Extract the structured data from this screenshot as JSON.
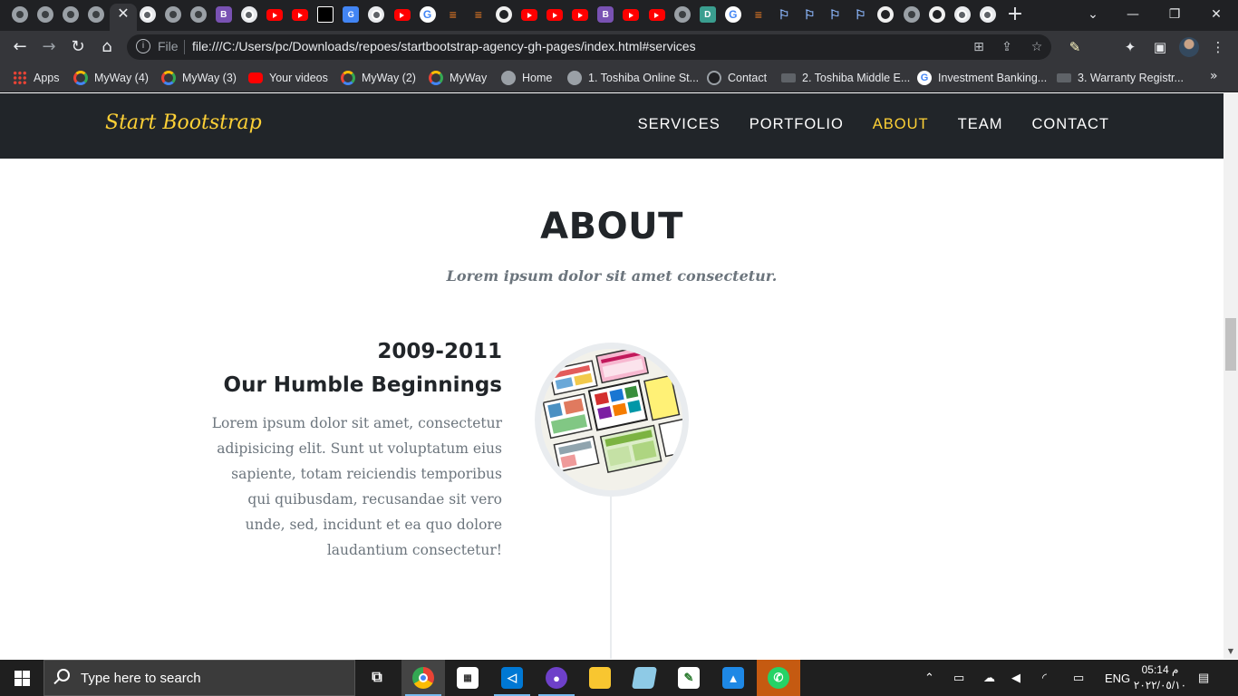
{
  "browser": {
    "address": {
      "scheme_label": "File",
      "url": "file:///C:/Users/pc/Downloads/repoes/startbootstrap-agency-gh-pages/index.html#services"
    },
    "tabs": [
      {
        "icon": "globe-icon",
        "kind": "gray"
      },
      {
        "icon": "globe-icon",
        "kind": "gray"
      },
      {
        "icon": "globe-icon",
        "kind": "gray"
      },
      {
        "icon": "globe-icon",
        "kind": "gray"
      },
      {
        "icon": "close-icon",
        "kind": "active"
      },
      {
        "icon": "chrome-icon",
        "kind": "chrome"
      },
      {
        "icon": "globe-icon",
        "kind": "gray"
      },
      {
        "icon": "globe-icon",
        "kind": "gray"
      },
      {
        "icon": "bootstrap-icon",
        "kind": "bs",
        "glyph": "B"
      },
      {
        "icon": "chrome-icon",
        "kind": "chrome"
      },
      {
        "icon": "youtube-icon",
        "kind": "yt"
      },
      {
        "icon": "youtube-icon",
        "kind": "yt"
      },
      {
        "icon": "dark-square-icon",
        "kind": "dark"
      },
      {
        "icon": "google-translate-icon",
        "kind": "gt",
        "glyph": "G"
      },
      {
        "icon": "chrome-icon",
        "kind": "chrome"
      },
      {
        "icon": "youtube-icon",
        "kind": "yt"
      },
      {
        "icon": "google-icon",
        "kind": "google",
        "glyph": "G"
      },
      {
        "icon": "stackoverflow-icon",
        "kind": "so",
        "glyph": "≡"
      },
      {
        "icon": "stackoverflow-icon",
        "kind": "so",
        "glyph": "≡"
      },
      {
        "icon": "github-icon",
        "kind": "gh"
      },
      {
        "icon": "youtube-icon",
        "kind": "yt"
      },
      {
        "icon": "youtube-icon",
        "kind": "yt"
      },
      {
        "icon": "youtube-icon",
        "kind": "yt"
      },
      {
        "icon": "bootstrap-icon",
        "kind": "bs",
        "glyph": "B"
      },
      {
        "icon": "youtube-icon",
        "kind": "yt"
      },
      {
        "icon": "youtube-icon",
        "kind": "yt"
      },
      {
        "icon": "globe-icon",
        "kind": "gray"
      },
      {
        "icon": "td-icon",
        "kind": "td",
        "glyph": "D"
      },
      {
        "icon": "google-icon",
        "kind": "google",
        "glyph": "G"
      },
      {
        "icon": "stackoverflow-icon",
        "kind": "so",
        "glyph": "≡"
      },
      {
        "icon": "flag-icon",
        "kind": "flag",
        "glyph": "⚐"
      },
      {
        "icon": "flag-icon",
        "kind": "flag",
        "glyph": "⚐"
      },
      {
        "icon": "flag-icon",
        "kind": "flag",
        "glyph": "⚐"
      },
      {
        "icon": "flag-icon",
        "kind": "flag",
        "glyph": "⚐"
      },
      {
        "icon": "github-icon",
        "kind": "gh"
      },
      {
        "icon": "globe-icon",
        "kind": "gray"
      },
      {
        "icon": "github-icon",
        "kind": "gh"
      },
      {
        "icon": "chrome-icon",
        "kind": "chrome"
      },
      {
        "icon": "chrome-icon",
        "kind": "chrome"
      }
    ],
    "bookmarks": [
      {
        "label": "Apps",
        "icon": "apps"
      },
      {
        "label": "MyWay (4)",
        "icon": "myway"
      },
      {
        "label": "MyWay (3)",
        "icon": "myway"
      },
      {
        "label": "Your videos",
        "icon": "yt"
      },
      {
        "label": "MyWay (2)",
        "icon": "myway"
      },
      {
        "label": "MyWay",
        "icon": "myway"
      },
      {
        "label": "Home",
        "icon": "globe"
      },
      {
        "label": "1. Toshiba Online St...",
        "icon": "globe"
      },
      {
        "label": "Contact",
        "icon": "contact"
      },
      {
        "label": "2. Toshiba Middle E...",
        "icon": "tosh"
      },
      {
        "label": "Investment Banking...",
        "icon": "google"
      },
      {
        "label": "3. Warranty Registr...",
        "icon": "tosh"
      }
    ]
  },
  "site": {
    "brand": "Start Bootstrap",
    "nav": [
      "Services",
      "Portfolio",
      "About",
      "Team",
      "Contact"
    ],
    "active_nav": "About",
    "accent_color": "#fed136",
    "about": {
      "title": "ABOUT",
      "subtitle": "Lorem ipsum dolor sit amet consectetur.",
      "timeline": [
        {
          "year": "2009-2011",
          "heading": "Our Humble Beginnings",
          "body": "Lorem ipsum dolor sit amet, consectetur adipisicing elit. Sunt ut voluptatum eius sapiente, totam reiciendis temporibus qui quibusdam, recusandae sit vero unde, sed, incidunt et ea quo dolore laudantium consectetur!"
        }
      ]
    }
  },
  "taskbar": {
    "search_placeholder": "Type here to search",
    "language": "ENG",
    "time": "05:14 م",
    "date": "٢٠٢٢/٠٥/١٠"
  }
}
